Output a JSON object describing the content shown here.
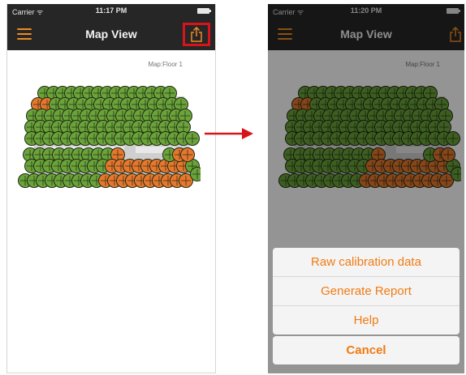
{
  "left_screen": {
    "status": {
      "carrier": "Carrier ᯤ",
      "time": "11:17 PM"
    },
    "nav": {
      "title": "Map View"
    },
    "map_label": "Map:Floor 1"
  },
  "right_screen": {
    "status": {
      "carrier": "Carrier ᯤ",
      "time": "11:20 PM"
    },
    "nav": {
      "title": "Map View"
    },
    "map_label": "Map:Floor 1",
    "action_sheet": {
      "items": [
        "Raw calibration data",
        "Generate Report",
        "Help"
      ],
      "cancel": "Cancel"
    }
  },
  "colors": {
    "accent": "#f07b12",
    "highlight_box": "#d8141b",
    "node_green": "#6aa33a",
    "node_orange": "#e8772e",
    "arrow": "#d8141b"
  }
}
